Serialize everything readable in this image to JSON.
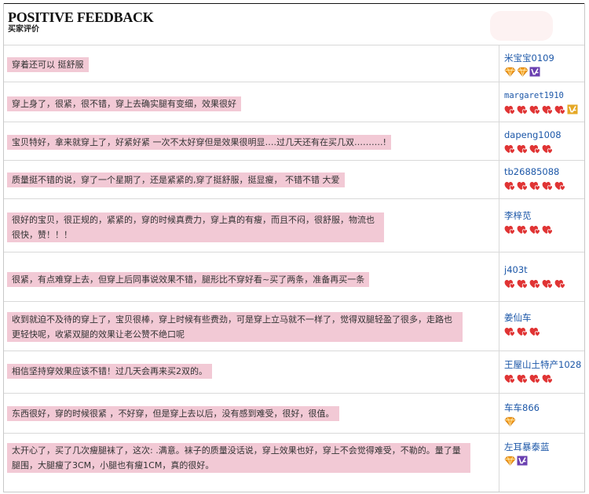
{
  "header": {
    "title": "POSITIVE FEEDBACK",
    "subtitle": "买家评价"
  },
  "colors": {
    "comment_highlight": "#f2c9d5",
    "username_link": "#1c57a8",
    "heart_red": "#e03434",
    "diamond_orange": "#f5a023",
    "vip_purple": "#6a3fb0",
    "vip_gold": "#e5a825"
  },
  "reviews": [
    {
      "comment": "穿着还可以 挺舒服",
      "username": "米宝宝0109",
      "badges": [
        "diamond-icon",
        "diamond-icon",
        "vip-purple-icon"
      ]
    },
    {
      "comment": "穿上身了，很紧，很不错，穿上去确实腿有变细，效果很好",
      "username": "margaret1910",
      "badges": [
        "heart-icon",
        "heart-icon",
        "heart-icon",
        "heart-icon",
        "heart-icon",
        "vip-gold-icon"
      ]
    },
    {
      "comment": "宝贝特好，拿来就穿上了，好紧好紧   一次不太好穿但是效果很明显….过几天还有在买几双……….!",
      "username": "dapeng1008",
      "badges": [
        "heart-icon",
        "heart-icon",
        "heart-icon",
        "heart-icon"
      ]
    },
    {
      "comment": "质量挺不错的说，穿了一个星期了，还是紧紧的,穿了挺舒服，挺显瘦， 不错不错 大爱",
      "username": "tb26885088",
      "badges": [
        "heart-icon",
        "heart-icon",
        "heart-icon",
        "heart-icon",
        "heart-icon"
      ]
    },
    {
      "comment": "很好的宝贝，很正规的，紧紧的，穿的时候真费力，穿上真的有瘦，而且不闷，很舒服，物流也很快，赞！！！",
      "username": "李梓苋",
      "badges": [
        "heart-icon",
        "heart-icon",
        "heart-icon",
        "heart-icon"
      ]
    },
    {
      "comment": "很紧，有点难穿上去，但穿上后同事说效果不错，腿形比不穿好看~买了两条，准备再买一条",
      "username": "j403t",
      "badges": [
        "heart-icon",
        "heart-icon",
        "heart-icon",
        "heart-icon",
        "heart-icon"
      ]
    },
    {
      "comment": "收到就迫不及待的穿上了，宝贝很棒，穿上时候有些费劲，可是穿上立马就不一样了，觉得双腿轻盈了很多，走路也更轻快呢，收紧双腿的效果让老公赞不绝口呢",
      "username": "姜仙车",
      "badges": [
        "heart-icon",
        "heart-icon",
        "heart-icon"
      ]
    },
    {
      "comment": "相信坚持穿效果应该不错！过几天会再来买2双的。",
      "username": "王屋山土特产1028",
      "badges": [
        "heart-icon",
        "heart-icon",
        "heart-icon",
        "heart-icon"
      ]
    },
    {
      "comment": "东西很好，穿的时候很紧 ，不好穿，但是穿上去以后，没有感到难受，很好，很值。",
      "username": "车车866",
      "badges": [
        "diamond-icon"
      ]
    },
    {
      "comment": "太开心了，买了几次瘦腿袜了，这次: .满意。袜子的质量没话说，穿上效果也好，穿上不会觉得难受，不勒的。量了量腿围，大腿瘦了3CM，小腿也有瘦1CM，真的很好。",
      "username": "左耳暴泰蓝",
      "badges": [
        "diamond-icon",
        "vip-purple-icon"
      ]
    }
  ]
}
